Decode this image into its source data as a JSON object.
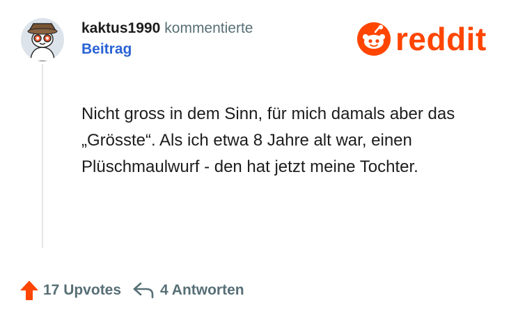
{
  "comment": {
    "author": "kaktus1990",
    "action": "kommentierte",
    "target": "Beitrag",
    "body": "Nicht gross in dem Sinn, für mich damals aber das „Grösste“. Als ich etwa 8 Jahre alt war, einen Plüschmaulwurf - den hat jetzt meine Tochter."
  },
  "brand": {
    "name": "reddit",
    "color": "#ff4500"
  },
  "stats": {
    "upvotes": "17 Upvotes",
    "replies": "4 Antworten"
  },
  "colors": {
    "accent": "#ff4500",
    "link": "#2a63d4",
    "muted": "#576f76",
    "text": "#1c1c1c"
  },
  "icons": {
    "avatar": "snoo-avatar-icon",
    "brand": "reddit-snoo-icon",
    "upvote": "upvote-arrow-icon",
    "reply": "reply-arrow-icon"
  }
}
